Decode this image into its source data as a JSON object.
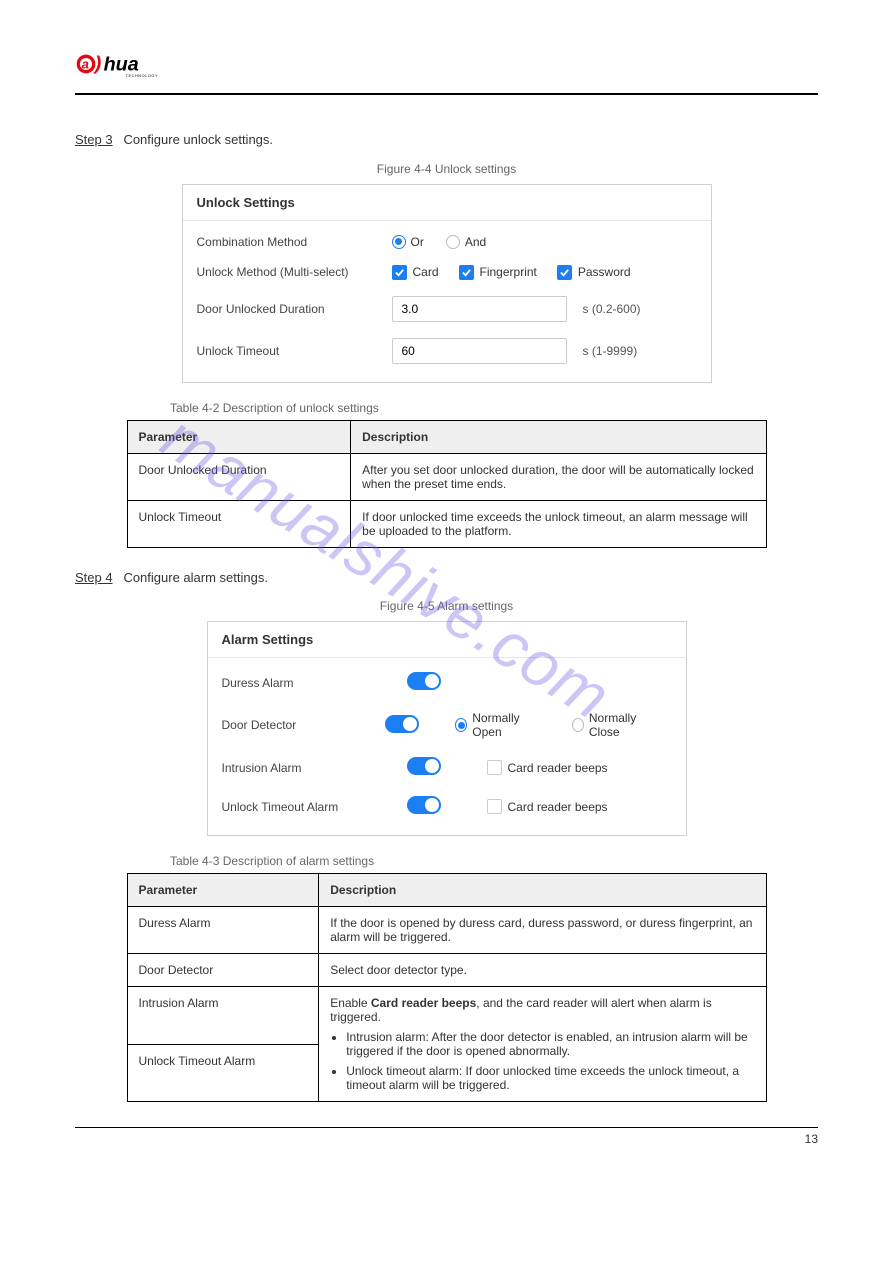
{
  "watermark": {
    "text": "manualshive.com"
  },
  "logo": {
    "brand_prefix": "a",
    "brand_mid": "l",
    "brand_suffix": "hua",
    "subtitle": "TECHNOLOGY"
  },
  "step3": {
    "label": "Step 3",
    "text": "Configure unlock settings."
  },
  "step4": {
    "label": "Step 4",
    "text": "Configure alarm settings."
  },
  "figure_unlock": "Figure 4-4 Unlock settings",
  "figure_alarm": "Figure 4-5 Alarm settings",
  "unlock_panel": {
    "title": "Unlock Settings",
    "rows": {
      "combination": {
        "label": "Combination Method",
        "opts": {
          "or": "Or",
          "and": "And"
        }
      },
      "method": {
        "label": "Unlock Method (Multi-select)",
        "opts": {
          "card": "Card",
          "fingerprint": "Fingerprint",
          "password": "Password"
        }
      },
      "duration": {
        "label": "Door Unlocked Duration",
        "value": "3.0",
        "unit": "s (0.2-600)"
      },
      "timeout": {
        "label": "Unlock Timeout",
        "value": "60",
        "unit": "s (1-9999)"
      }
    }
  },
  "unlock_table_caption": "Table 4-2 Description of unlock settings",
  "unlock_table": {
    "headers": {
      "param": "Parameter",
      "desc": "Description"
    },
    "rows": [
      {
        "param": "Door Unlocked Duration",
        "desc": "After you set door unlocked duration, the door will be automatically locked when the preset time ends."
      },
      {
        "param": "Unlock Timeout",
        "desc": "If door unlocked time exceeds the unlock timeout, an alarm message will be uploaded to the platform."
      }
    ]
  },
  "alarm_panel": {
    "title": "Alarm Settings",
    "rows": {
      "duress": {
        "label": "Duress Alarm"
      },
      "detector": {
        "label": "Door Detector",
        "open": "Normally Open",
        "close": "Normally Close"
      },
      "intrusion": {
        "label": "Intrusion Alarm",
        "beep": "Card reader beeps"
      },
      "timeout": {
        "label": "Unlock Timeout Alarm",
        "beep": "Card reader beeps"
      }
    }
  },
  "alarm_table_caption": "Table 4-3 Description of alarm settings",
  "alarm_table": {
    "headers": {
      "param": "Parameter",
      "desc": "Description"
    },
    "rows": [
      {
        "param": "Duress Alarm",
        "desc": "If the door is opened by duress card, duress password, or duress fingerprint, an alarm will be triggered."
      },
      {
        "param": "Door Detector",
        "desc": "Select door detector type."
      },
      {
        "param": "Intrusion Alarm",
        "desc_prefix": "Enable ",
        "desc_bold": "Card reader beeps",
        "desc_suffix": ", and the card reader will alert when alarm is triggered."
      },
      {
        "param": "Unlock Timeout Alarm",
        "desc": ""
      },
      {
        "param_list_header": "",
        "list": [
          "Intrusion alarm: After the door detector is enabled, an intrusion alarm will be triggered if the door is opened abnormally.",
          "Unlock timeout alarm: If door unlocked time exceeds the unlock timeout, a timeout alarm will be triggered."
        ]
      }
    ]
  },
  "page_number": "13"
}
